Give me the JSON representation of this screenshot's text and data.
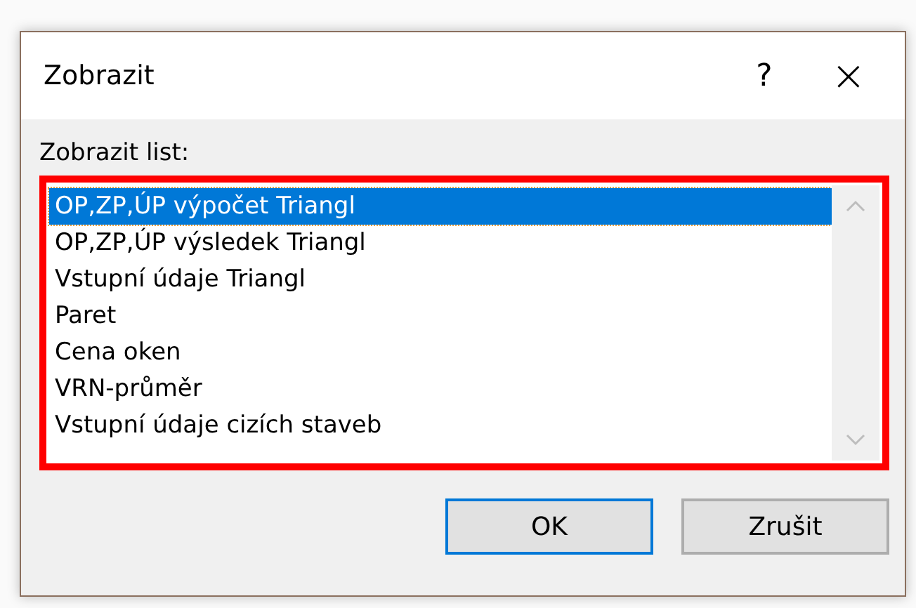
{
  "window": {
    "title": "Zobrazit",
    "help": "?",
    "close": "×"
  },
  "list_label": "Zobrazit list:",
  "list": {
    "highlighted": true,
    "items": [
      {
        "label": "OP,ZP,ÚP výpočet Triangl",
        "selected": true
      },
      {
        "label": "OP,ZP,ÚP výsledek Triangl",
        "selected": false
      },
      {
        "label": "Vstupní údaje Triangl",
        "selected": false
      },
      {
        "label": "Paret",
        "selected": false
      },
      {
        "label": "Cena oken",
        "selected": false
      },
      {
        "label": "VRN-průměr",
        "selected": false
      },
      {
        "label": "Vstupní údaje cizích staveb",
        "selected": false
      }
    ]
  },
  "buttons": [
    {
      "label": "OK",
      "default": true
    },
    {
      "label": "Zrušit",
      "default": false
    }
  ]
}
